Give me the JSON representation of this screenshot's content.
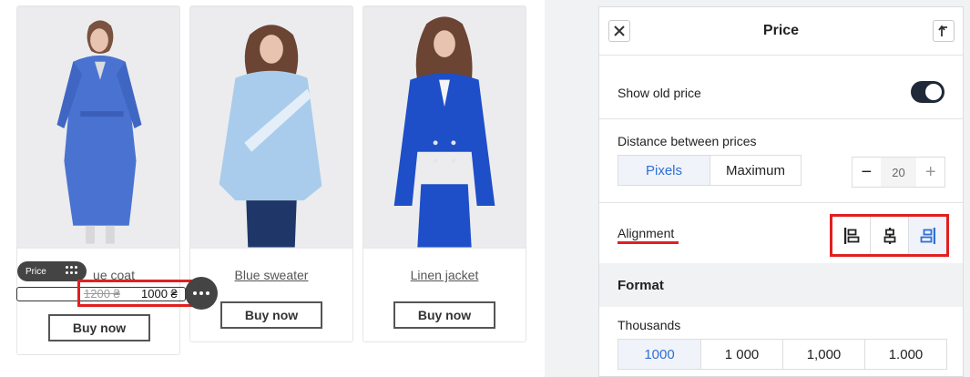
{
  "products": [
    {
      "name": "Blue coat",
      "name_visible": "ue coat",
      "buy_label": "Buy now"
    },
    {
      "name": "Blue sweater",
      "buy_label": "Buy now"
    },
    {
      "name": "Linen jacket",
      "buy_label": "Buy now"
    }
  ],
  "price_widget": {
    "tag_label": "Price",
    "old_price": "1200 ₴",
    "new_price": "1000 ₴"
  },
  "panel": {
    "title": "Price",
    "show_old_price": {
      "label": "Show old price",
      "enabled": true
    },
    "distance": {
      "label": "Distance between prices",
      "modes": [
        "Pixels",
        "Maximum"
      ],
      "selected_mode": "Pixels",
      "value": "20"
    },
    "alignment": {
      "label": "Alignment",
      "options": [
        "left",
        "center",
        "right"
      ],
      "selected": "right"
    },
    "format": {
      "section_title": "Format",
      "thousands_label": "Thousands",
      "thousands_options": [
        "1000",
        "1 000",
        "1,000",
        "1.000"
      ],
      "thousands_selected": "1000"
    }
  },
  "colors": {
    "accent": "#2f6fd6",
    "highlight_red": "#e02020",
    "toggle_on": "#1f2937",
    "product_blue": "#3d66c9"
  }
}
